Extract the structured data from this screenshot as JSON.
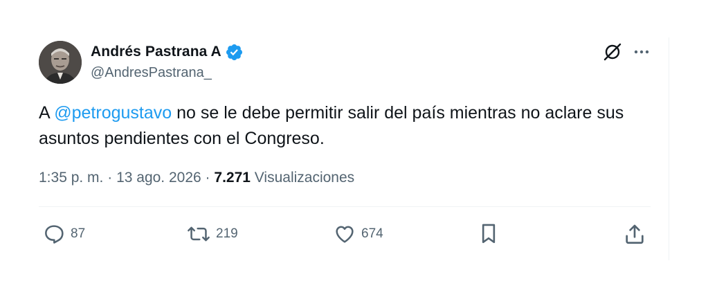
{
  "author": {
    "display_name": "Andrés Pastrana A",
    "handle": "@AndresPastrana_",
    "verified": true
  },
  "tweet": {
    "text_prefix": "A ",
    "mention": "@petrogustavo",
    "text_suffix": " no se le debe permitir salir del país mientras no aclare sus asuntos pendientes con el Congreso."
  },
  "meta": {
    "time": "1:35 p. m.",
    "separator": "·",
    "date": "13 ago. 2026",
    "views_count": "7.271",
    "views_label": "Visualizaciones"
  },
  "actions": {
    "replies": "87",
    "reposts": "219",
    "likes": "674"
  },
  "icons": {
    "verified": "verified-badge-icon",
    "grok": "grok-icon",
    "more": "more-options-icon",
    "reply": "reply-icon",
    "repost": "repost-icon",
    "like": "like-heart-icon",
    "bookmark": "bookmark-icon",
    "share": "share-icon"
  },
  "colors": {
    "text": "#0f1419",
    "secondary": "#536471",
    "accent": "#1d9bf0",
    "divider": "#eff3f4"
  }
}
